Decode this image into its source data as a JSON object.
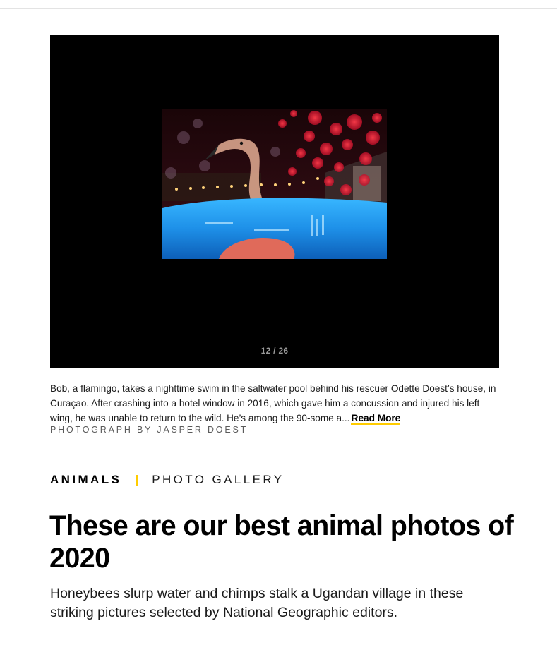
{
  "gallery": {
    "counter": "12 / 26",
    "caption": "Bob, a flamingo, takes a nighttime swim in the saltwater pool behind his rescuer Odette Doest’s house, in Curaçao. After crashing into a hotel window in 2016, which gave him a concussion and injured his left wing, he was unable to return to the wild. He’s among the 90-some a...",
    "read_more_label": "Read More",
    "credit": "PHOTOGRAPH BY JASPER DOEST"
  },
  "article": {
    "category": "ANIMALS",
    "content_type": "PHOTO GALLERY",
    "headline": "These are our best animal photos of 2020",
    "dek": "Honeybees slurp water and chimps stalk a Ugandan village in these striking pictures selected by National Geographic editors."
  },
  "colors": {
    "accent": "#ffcc00",
    "gallery_background": "#000000"
  }
}
